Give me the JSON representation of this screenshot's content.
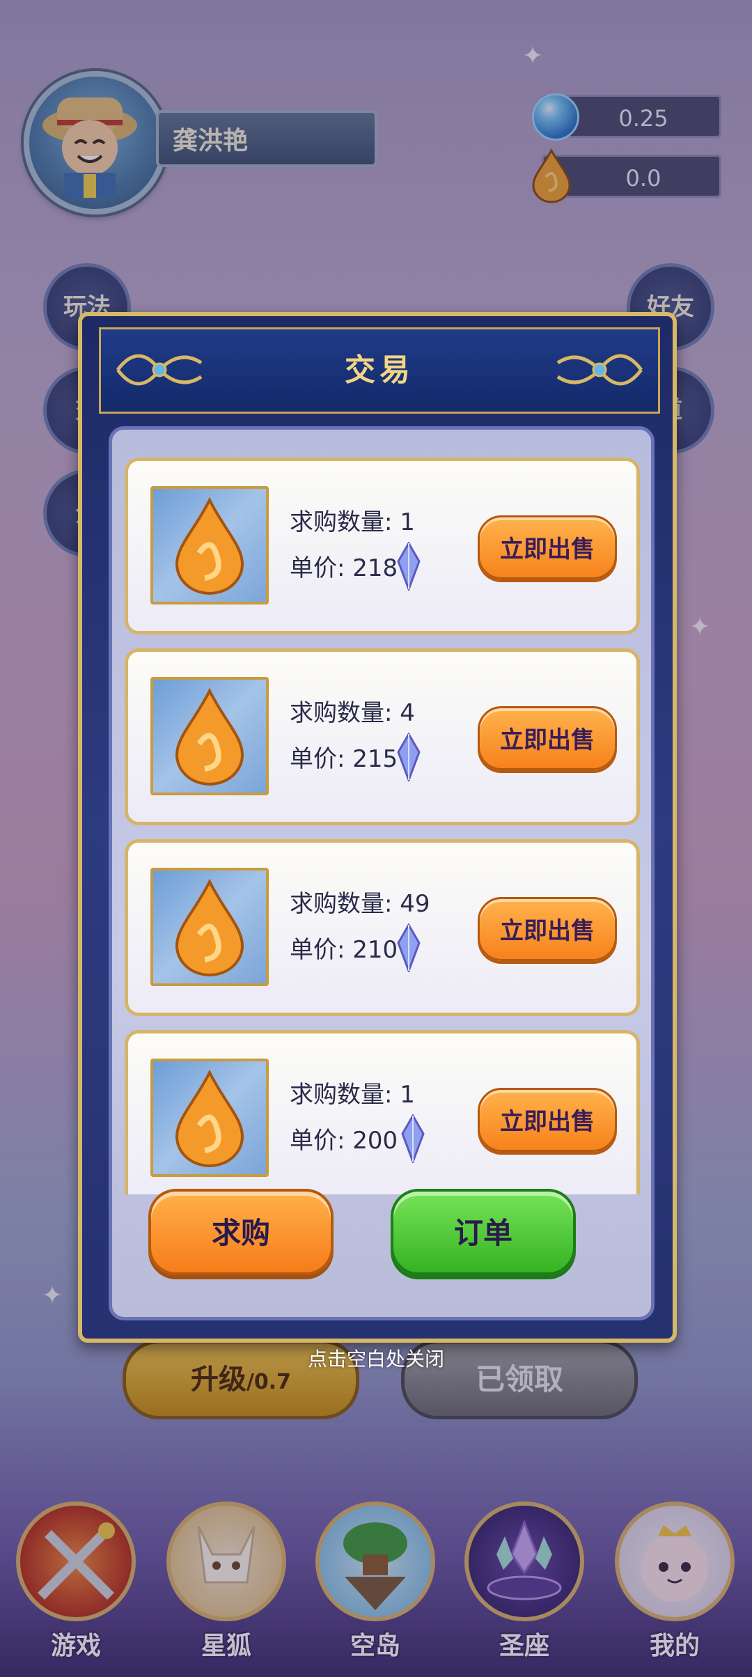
{
  "profile": {
    "name": "龚洪艳"
  },
  "currencies": {
    "bubble": "0.25",
    "amber": "0.0"
  },
  "side_buttons": {
    "left": [
      "玩法",
      "交",
      "分"
    ],
    "right": [
      "好友",
      "道"
    ]
  },
  "actions": {
    "upgrade": "升级",
    "upgrade_cost": "/0.7",
    "claimed": "已领取"
  },
  "modal": {
    "title": "交易",
    "qty_label": "求购数量: ",
    "price_label": "单价: ",
    "sell_label": "立即出售",
    "orders": [
      {
        "qty": "1",
        "price": "218"
      },
      {
        "qty": "4",
        "price": "215"
      },
      {
        "qty": "49",
        "price": "210"
      },
      {
        "qty": "1",
        "price": "200"
      }
    ],
    "buy_button": "求购",
    "order_button": "订单",
    "close_hint": "点击空白处关闭"
  },
  "nav": [
    {
      "label": "游戏",
      "icon": "swords-icon"
    },
    {
      "label": "星狐",
      "icon": "fox-icon"
    },
    {
      "label": "空岛",
      "icon": "island-icon"
    },
    {
      "label": "圣座",
      "icon": "crystal-throne-icon"
    },
    {
      "label": "我的",
      "icon": "cloud-mascot-icon"
    }
  ],
  "colors": {
    "accent_gold": "#d7b868",
    "sell_orange": "#f7821c",
    "order_green": "#34b323",
    "panel_navy": "#1d2a66"
  }
}
